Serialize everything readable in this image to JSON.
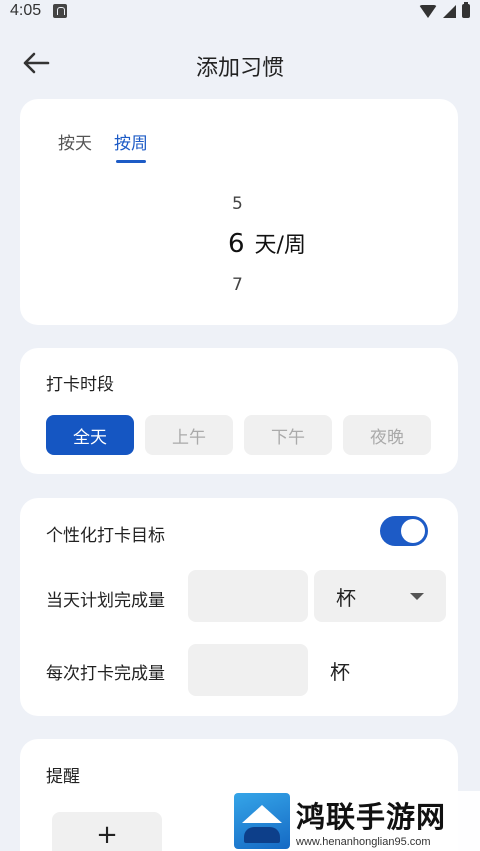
{
  "status_bar": {
    "time": "4:05"
  },
  "header": {
    "title": "添加习惯"
  },
  "frequency": {
    "tabs": [
      {
        "label": "按天",
        "active": false
      },
      {
        "label": "按周",
        "active": true
      }
    ],
    "picker": {
      "prev": "5",
      "current": "6",
      "next": "7",
      "unit": "天/周"
    }
  },
  "period": {
    "label": "打卡时段",
    "options": [
      "全天",
      "上午",
      "下午",
      "夜晚"
    ],
    "selected": "全天"
  },
  "goal": {
    "label": "个性化打卡目标",
    "toggle_on": true,
    "daily_label": "当天计划完成量",
    "daily_value": "",
    "daily_unit": "杯",
    "per_checkin_label": "每次打卡完成量",
    "per_checkin_value": "",
    "per_checkin_unit": "杯"
  },
  "reminder": {
    "label": "提醒",
    "add_label": "+"
  },
  "watermark": {
    "title": "鸿联手游网",
    "url": "www.henanhonglian95.com"
  },
  "colors": {
    "accent": "#1556c2",
    "background": "#eef1f7",
    "card": "#ffffff"
  }
}
